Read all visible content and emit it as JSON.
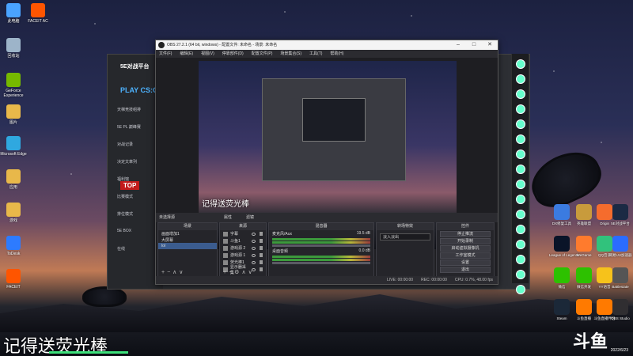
{
  "desktop": {
    "left_icons": [
      {
        "label": "此电脑",
        "icon": "computer-icon",
        "color": "#4aa3ff"
      },
      {
        "label": "回收站",
        "icon": "recycle-bin-icon",
        "color": "#9db4c9"
      },
      {
        "label": "GeForce Experience",
        "icon": "geforce-icon",
        "color": "#76b900"
      },
      {
        "label": "图片",
        "icon": "image-folder-icon",
        "color": "#e8b84a"
      },
      {
        "label": "Microsoft Edge",
        "icon": "edge-icon",
        "color": "#2fa8e0"
      },
      {
        "label": "应用",
        "icon": "folder-icon",
        "color": "#e8b84a"
      },
      {
        "label": "游戏",
        "icon": "folder-icon",
        "color": "#e8b84a"
      },
      {
        "label": "ToDesk",
        "icon": "todesk-icon",
        "color": "#2d7bff"
      },
      {
        "label": "FACEIT",
        "icon": "faceit-icon",
        "color": "#ff5500"
      }
    ],
    "top_icon": {
      "label": "FACEIT AC",
      "icon": "faceit-ac-icon",
      "color": "#ff5500"
    },
    "right_icons": [
      {
        "label": "DX修复工具",
        "icon": "dx-icon",
        "color": "#3b7be0"
      },
      {
        "label": "英雄联盟",
        "icon": "lol-icon",
        "color": "#c89b3c"
      },
      {
        "label": "Origin",
        "icon": "origin-icon",
        "color": "#f56c2d"
      },
      {
        "label": "5E对战平台",
        "icon": "5e-icon",
        "color": "#1c2a44"
      },
      {
        "label": "League of Legends",
        "icon": "league-icon",
        "color": "#0a1428"
      },
      {
        "label": "WeGame",
        "icon": "wegame-icon",
        "color": "#ff7b2d"
      },
      {
        "label": "QQ音乐",
        "icon": "qqmusic-icon",
        "color": "#31c27c"
      },
      {
        "label": "网易UU加速器",
        "icon": "uu-icon",
        "color": "#2b6cff"
      },
      {
        "label": "微信",
        "icon": "wechat-icon",
        "color": "#2dc100"
      },
      {
        "label": "微信开发",
        "icon": "wechat2-icon",
        "color": "#2dc100"
      },
      {
        "label": "YY语音",
        "icon": "yy-icon",
        "color": "#f6c21b"
      },
      {
        "label": "Battlestate",
        "icon": "battlestate-icon",
        "color": "#555555"
      },
      {
        "label": "Steam",
        "icon": "steam-icon",
        "color": "#1b2838"
      },
      {
        "label": "斗鱼直播",
        "icon": "douyu-icon",
        "color": "#ff7a00"
      },
      {
        "label": "斗鱼直播伴侣",
        "icon": "douyu-companion-icon",
        "color": "#ff7a00"
      },
      {
        "label": "OBS Studio",
        "icon": "obs-icon",
        "color": "#302e31"
      }
    ]
  },
  "bg_app": {
    "brand": "5E对战平台",
    "banner": "PLAY CS:GO",
    "items": [
      "天梯竞技组排",
      "5E PL 巅峰赛",
      "对战记录",
      "决定文章列",
      "福利馆",
      "比赛模式",
      "排位模式",
      "5E BOX",
      "在线"
    ],
    "top_label": "TOP"
  },
  "obs": {
    "title": "OBS 27.2.1 (64 bit, windows) - 配置文件: 未命名 - 场景: 未命名",
    "menu": [
      "文件(F)",
      "编辑(E)",
      "视图(V)",
      "停靠部件(D)",
      "配置文件(P)",
      "场景集合(S)",
      "工具(T)",
      "帮助(H)"
    ],
    "preview_caption": "记得送荧光棒",
    "preview_logo": "斗鱼",
    "source_bar": {
      "label": "未选择源",
      "props": "属性",
      "filters": "滤镜"
    },
    "scenes": {
      "title": "场景",
      "items": [
        "画面增加1",
        "大屏幕",
        "lol"
      ]
    },
    "sources": {
      "title": "来源",
      "items": [
        "字幕",
        "斗鱼1",
        "游戏源 2",
        "游戏源 1",
        "荧光棒1",
        "显示器采集"
      ]
    },
    "mixer": {
      "title": "混音器",
      "tracks": [
        {
          "name": "麦克风/Aux",
          "db": "19.5 dB"
        },
        {
          "name": "桌面音频",
          "db": "0.0 dB"
        }
      ]
    },
    "transitions": {
      "title": "转场特效",
      "selected": "淡入淡出"
    },
    "controls": {
      "title": "控件",
      "buttons": [
        "停止推流",
        "开始录制",
        "启动虚拟摄像机",
        "工作室模式",
        "设置",
        "退出"
      ]
    },
    "status": {
      "live": "LIVE: 00:00:00",
      "rec": "REC: 00:00:00",
      "cpu": "CPU: 0.7%, 48.00 fps"
    }
  },
  "overlay": {
    "caption": "记得送荧光棒",
    "logo": "斗鱼",
    "clock": "2022/6/23"
  }
}
